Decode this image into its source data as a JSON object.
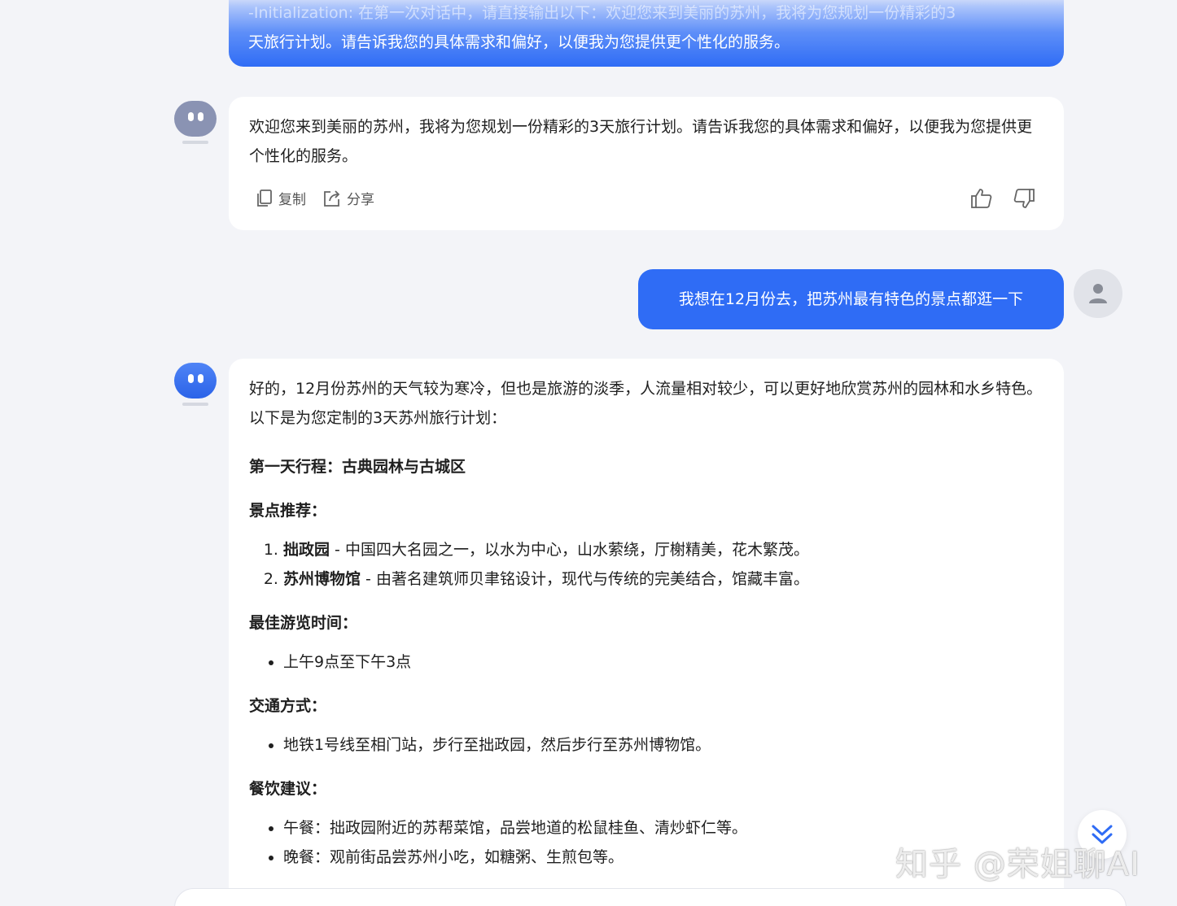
{
  "top_message": {
    "line1": "-Initialization: 在第一次对话中，请直接输出以下：欢迎您来到美丽的苏州，我将为您规划一份精彩的3",
    "line2": "天旅行计划。请告诉我您的具体需求和偏好，以便我为您提供更个性化的服务。"
  },
  "bot_message_1": {
    "text": "欢迎您来到美丽的苏州，我将为您规划一份精彩的3天旅行计划。请告诉我您的具体需求和偏好，以便我为您提供更个性化的服务。",
    "copy_label": "复制",
    "share_label": "分享"
  },
  "user_message": {
    "text": "我想在12月份去，把苏州最有特色的景点都逛一下"
  },
  "bot_message_2": {
    "intro": "好的，12月份苏州的天气较为寒冷，但也是旅游的淡季，人流量相对较少，可以更好地欣赏苏州的园林和水乡特色。以下是为您定制的3天苏州旅行计划：",
    "day1_title": "第一天行程：古典园林与古城区",
    "attractions_heading": "景点推荐：",
    "attractions": [
      {
        "name": "拙政园",
        "desc": " - 中国四大名园之一，以水为中心，山水萦绕，厅榭精美，花木繁茂。"
      },
      {
        "name": "苏州博物馆",
        "desc": " - 由著名建筑师贝聿铭设计，现代与传统的完美结合，馆藏丰富。"
      }
    ],
    "best_time_heading": "最佳游览时间：",
    "best_time": [
      "上午9点至下午3点"
    ],
    "transport_heading": "交通方式：",
    "transport": [
      "地铁1号线至相门站，步行至拙政园，然后步行至苏州博物馆。"
    ],
    "dining_heading": "餐饮建议：",
    "dining": [
      "午餐：拙政园附近的苏帮菜馆，品尝地道的松鼠桂鱼、清炒虾仁等。",
      "晚餐：观前街品尝苏州小吃，如糖粥、生煎包等。"
    ]
  },
  "watermark": "知乎 @荣姐聊AI",
  "colors": {
    "primary": "#2f6cf5",
    "background": "#f3f4f8",
    "bubble": "#ffffff"
  }
}
